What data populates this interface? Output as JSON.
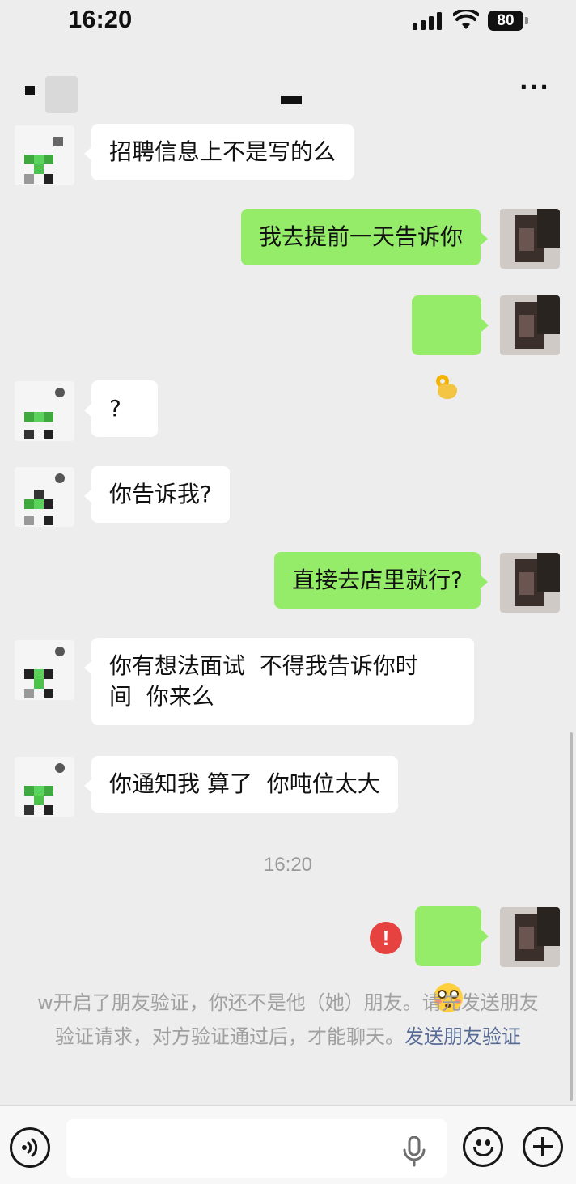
{
  "status_bar": {
    "time": "16:20",
    "battery": "80",
    "icons": [
      "signal-icon",
      "wifi-icon",
      "battery-icon"
    ]
  },
  "nav": {
    "back_icon": "back-icon",
    "more_icon": "more-icon"
  },
  "messages": [
    {
      "side": "left",
      "text": "招聘信息上不是写的么"
    },
    {
      "side": "right",
      "text": "我去提前一天告诉你"
    },
    {
      "side": "right",
      "emoji": "ok-hand-emoji"
    },
    {
      "side": "left",
      "text": "?"
    },
    {
      "side": "left",
      "text": "你告诉我?"
    },
    {
      "side": "right",
      "text": "直接去店里就行?"
    },
    {
      "side": "left",
      "text": "你有想法面试  不得我告诉你时\n间  你来么"
    },
    {
      "side": "left",
      "text": "你通知我 算了  你吨位太大"
    },
    {
      "side": "right",
      "emoji": "flushed-face-emoji",
      "status": "failed"
    }
  ],
  "timestamp": "16:20",
  "system_notice": {
    "text": "w开启了朋友验证，你还不是他（她）朋友。请先发送朋友验证请求，对方验证通过后，才能聊天。",
    "link": "发送朋友验证"
  },
  "error_mark": "!",
  "input_bar": {
    "value": "",
    "icons": [
      "voice-icon",
      "mic-icon",
      "emoji-icon",
      "plus-icon"
    ]
  },
  "colors": {
    "background": "#ededed",
    "bubble_self": "#95ec69",
    "bubble_other": "#ffffff",
    "link": "#576b95",
    "error": "#e64340"
  }
}
